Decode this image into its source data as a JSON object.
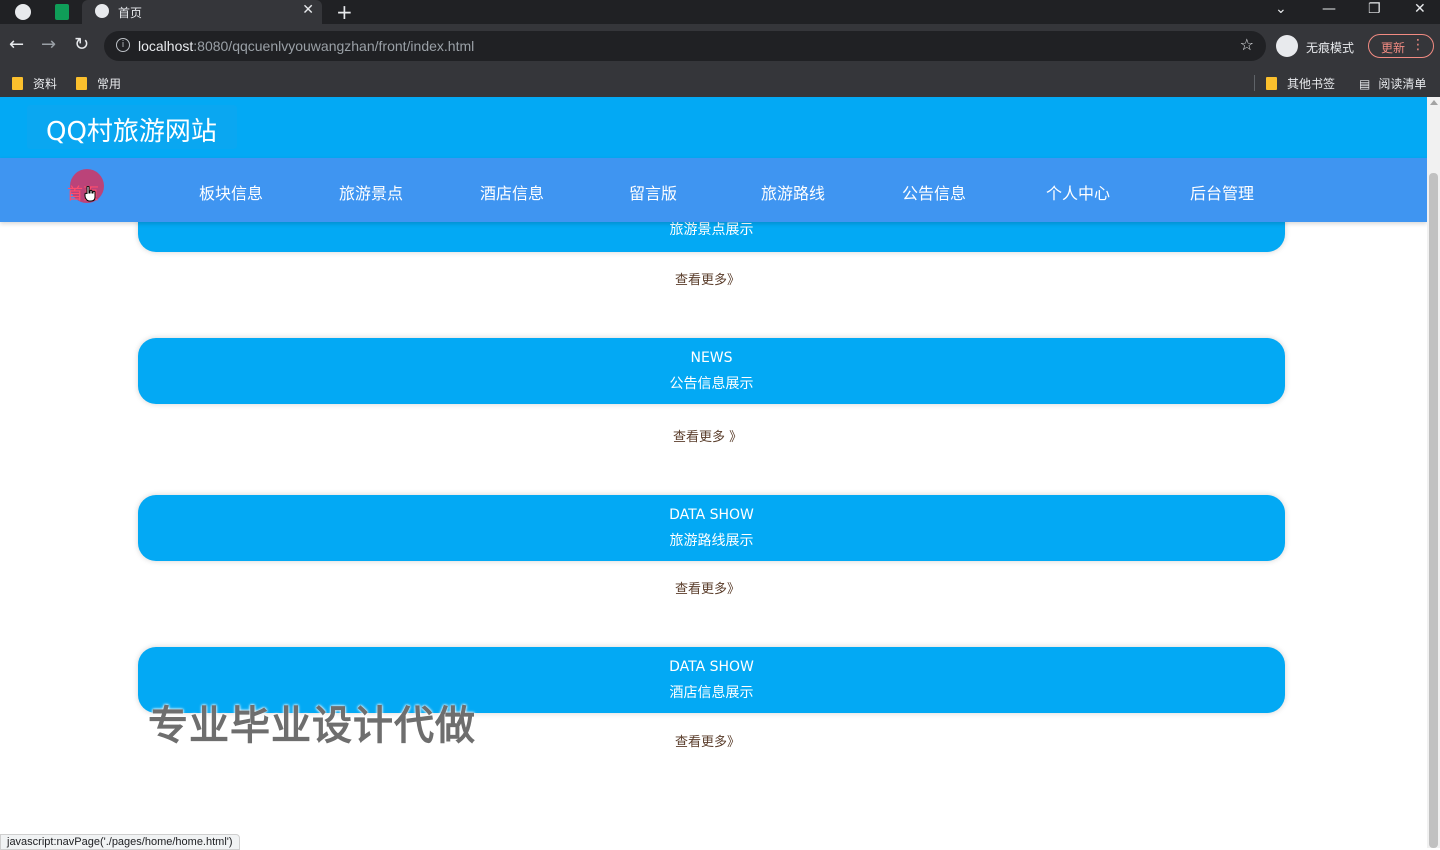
{
  "browser": {
    "tab_title": "首页",
    "url_host": "localhost",
    "url_rest": ":8080/qqcuenlvyouwangzhan/front/index.html",
    "incognito_label": "无痕模式",
    "update_label": "更新",
    "bookmarks": [
      "资料",
      "常用"
    ],
    "bookmarks_right": [
      "其他书签",
      "阅读清单"
    ]
  },
  "site": {
    "logo": "QQ村旅游网站",
    "nav": [
      "首页",
      "板块信息",
      "旅游景点",
      "酒店信息",
      "留言版",
      "旅游路线",
      "公告信息",
      "个人中心",
      "后台管理"
    ],
    "active_nav": "首页"
  },
  "sections": [
    {
      "en": "",
      "cn": "旅游景点展示",
      "more": "查看更多》"
    },
    {
      "en": "NEWS",
      "cn": "公告信息展示",
      "more": "查看更多 》"
    },
    {
      "en": "DATA SHOW",
      "cn": "旅游路线展示",
      "more": "查看更多》"
    },
    {
      "en": "DATA SHOW",
      "cn": "酒店信息展示",
      "more": "查看更多》"
    }
  ],
  "watermark": "专业毕业设计代做",
  "status_url": "javascript:navPage('./pages/home/home.html')"
}
